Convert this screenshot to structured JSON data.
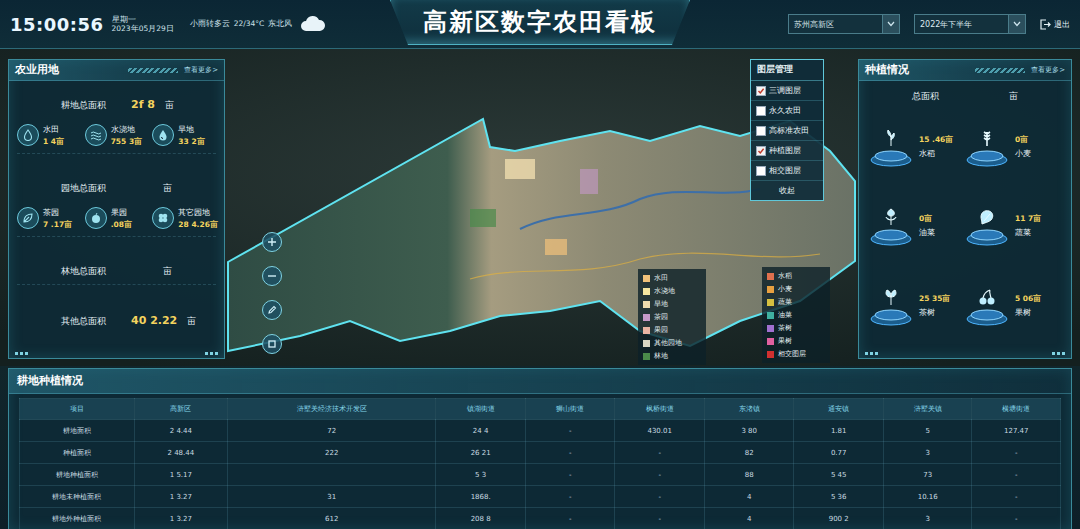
{
  "header": {
    "time": "15:00:56",
    "weekday": "星期一",
    "date": "2023年05月29日",
    "weather": "小雨转多云",
    "temperature": "22/34°C",
    "wind": "东北风",
    "title": "高新区数字农田看板",
    "region_select": "苏州高新区",
    "period_select": "2022年下半年",
    "exit": "退出"
  },
  "land_panel": {
    "title": "农业用地",
    "more": "查看更多>",
    "sections": [
      {
        "label": "耕地总面积",
        "value": "2f 8",
        "unit": "亩",
        "items": [
          {
            "label": "水田",
            "value": "1 4亩"
          },
          {
            "label": "水浇地",
            "value": "755 3亩"
          },
          {
            "label": "旱地",
            "value": "33 2亩"
          }
        ]
      },
      {
        "label": "园地总面积",
        "value": "",
        "unit": "亩",
        "items": [
          {
            "label": "茶园",
            "value": "7 .17亩"
          },
          {
            "label": "果园",
            "value": ".08亩"
          },
          {
            "label": "其它园地",
            "value": "28 4.26亩"
          }
        ]
      },
      {
        "label": "林地总面积",
        "value": "",
        "unit": "亩",
        "items": []
      },
      {
        "label": "其他总面积",
        "value": "40 2.22",
        "unit": "亩",
        "items": []
      }
    ]
  },
  "layers": {
    "title": "图层管理",
    "collapse": "收起",
    "items": [
      {
        "label": "三调图层",
        "checked": true
      },
      {
        "label": "永久农田",
        "checked": false
      },
      {
        "label": "高标准农田",
        "checked": false
      },
      {
        "label": "种植图层",
        "checked": true
      },
      {
        "label": "相交图层",
        "checked": false
      }
    ]
  },
  "legend_land": [
    {
      "label": "水田",
      "color": "#f2c27a"
    },
    {
      "label": "水浇地",
      "color": "#f6e6a0"
    },
    {
      "label": "旱地",
      "color": "#efdcae"
    },
    {
      "label": "茶园",
      "color": "#c79ac9"
    },
    {
      "label": "果园",
      "color": "#e8b4a4"
    },
    {
      "label": "其他园地",
      "color": "#d9d6c4"
    },
    {
      "label": "林地",
      "color": "#4a8a4a"
    }
  ],
  "legend_crop": [
    {
      "label": "水稻",
      "color": "#e0704e"
    },
    {
      "label": "小麦",
      "color": "#e8a040"
    },
    {
      "label": "蔬菜",
      "color": "#d6c040"
    },
    {
      "label": "油菜",
      "color": "#3fb0a0"
    },
    {
      "label": "茶树",
      "color": "#a070d0"
    },
    {
      "label": "果树",
      "color": "#e060a0"
    },
    {
      "label": "相交图层",
      "color": "#d03030"
    }
  ],
  "crop_panel": {
    "title": "种植情况",
    "more": "查看更多>",
    "total_label": "总面积",
    "total_unit": "亩",
    "items": [
      {
        "label": "水稻",
        "value": "15 .46亩"
      },
      {
        "label": "小麦",
        "value": "0亩"
      },
      {
        "label": "油菜",
        "value": "0亩"
      },
      {
        "label": "蔬菜",
        "value": "11 7亩"
      },
      {
        "label": "茶树",
        "value": "25 35亩"
      },
      {
        "label": "果树",
        "value": "5 06亩"
      }
    ]
  },
  "table": {
    "title": "耕地种植情况",
    "columns": [
      "项目",
      "高新区",
      "浒墅关经济技术开发区",
      "镇湖街道",
      "狮山街道",
      "枫桥街道",
      "东渚镇",
      "通安镇",
      "浒墅关镇",
      "横塘街道"
    ],
    "rows": [
      [
        "耕地面积",
        "2 4.44",
        "72",
        "24 4",
        "-",
        "430.01",
        "3 80",
        "1.81",
        "5",
        "127.47"
      ],
      [
        "种植面积",
        "2 48.44",
        "222",
        "26 21",
        "-",
        "-",
        "82",
        "0.77",
        "3",
        "-"
      ],
      [
        "耕地种植面积",
        "1 5.17",
        "",
        "5 3",
        "-",
        "-",
        "88",
        "5 45",
        "73",
        "-"
      ],
      [
        "耕地未种植面积",
        "1 3.27",
        "31",
        "1868.",
        "-",
        "-",
        "4",
        "5 36",
        "10.16",
        "-"
      ],
      [
        "耕地外种植面积",
        "1 3.27",
        "612",
        "208 8",
        "-",
        "-",
        "4",
        "900 2",
        "3",
        "-"
      ]
    ]
  }
}
